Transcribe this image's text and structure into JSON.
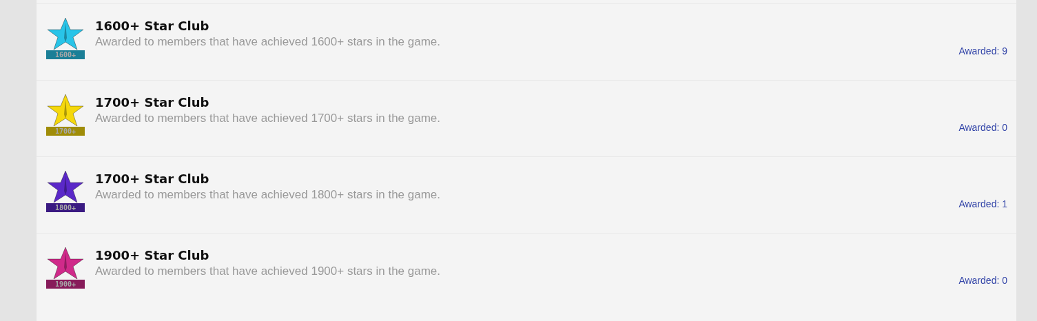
{
  "awards": [
    {
      "title": "1600+ Star Club",
      "description": "Awarded to members that have achieved 1600+ stars in the game.",
      "badge_label": "1600+",
      "color": "#29c4e8",
      "awarded": "Awarded: 9"
    },
    {
      "title": "1700+ Star Club",
      "description": "Awarded to members that have achieved 1700+ stars in the game.",
      "badge_label": "1700+",
      "color": "#f5d80c",
      "awarded": "Awarded: 0"
    },
    {
      "title": "1700+ Star Club",
      "description": "Awarded to members that have achieved 1800+ stars in the game.",
      "badge_label": "1800+",
      "color": "#5a28c8",
      "awarded": "Awarded: 1"
    },
    {
      "title": "1900+ Star Club",
      "description": "Awarded to members that have achieved 1900+ stars in the game.",
      "badge_label": "1900+",
      "color": "#d02a8a",
      "awarded": "Awarded: 0"
    }
  ]
}
